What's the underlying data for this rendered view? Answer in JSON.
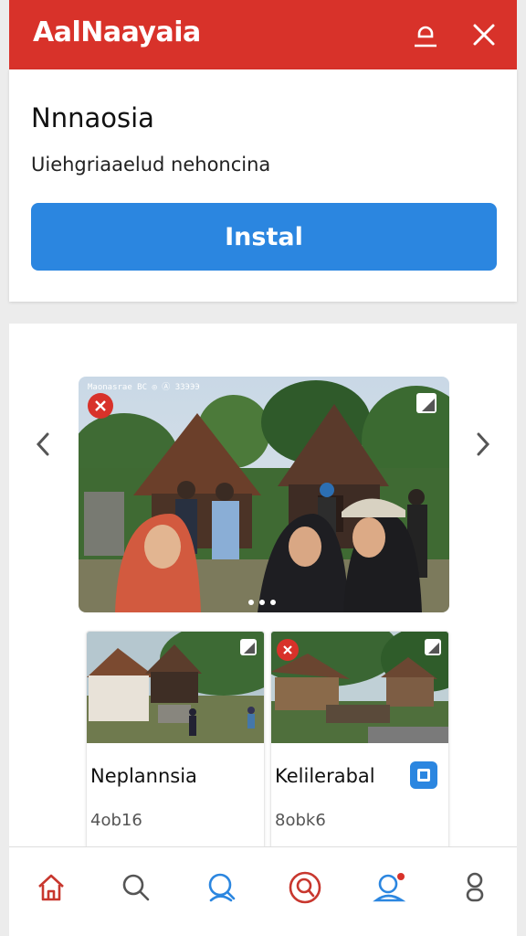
{
  "header": {
    "title": "AalNaayaia",
    "icons": [
      "user-icon",
      "close-icon"
    ],
    "color": "#d8322a"
  },
  "app": {
    "name": "Nnnaosia",
    "description": "Uiehgriaaelud nehoncina",
    "install_label": "Instal",
    "accent": "#2b86e0"
  },
  "gallery": {
    "hero_caption": "Maonasrae BC ◎    Ⓐ ЗЗЭЭЭ",
    "page_dots": 3,
    "tiles": [
      {
        "name": "Neplannsia",
        "code": "4ob16"
      },
      {
        "name": "Kelilerabal",
        "code": "8obk6"
      }
    ]
  },
  "bottom_nav": {
    "items": [
      "home-icon",
      "search-icon",
      "user-search-icon",
      "chat-search-icon",
      "people-notification-icon",
      "profile-icon"
    ]
  }
}
